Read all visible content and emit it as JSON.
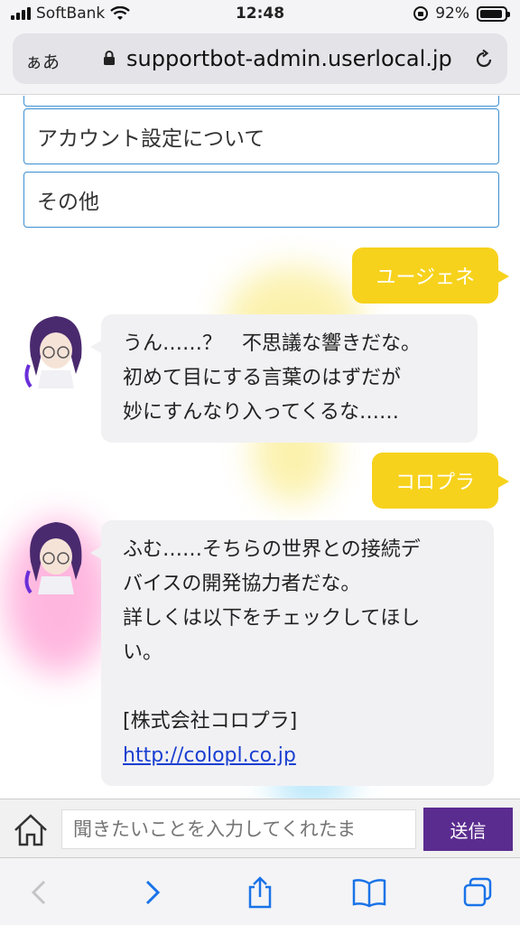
{
  "status": {
    "carrier": "SoftBank",
    "time": "12:48",
    "battery_text": "92%",
    "battery_level": 0.92
  },
  "browser": {
    "aa_label": "ぁあ",
    "url": "supportbot-admin.userlocal.jp",
    "icons": [
      "padlock-icon",
      "reload-icon"
    ]
  },
  "chat": {
    "choices": [
      "アカウント設定について",
      "その他"
    ],
    "user_messages": [
      "ユージェネ",
      "コロプラ"
    ],
    "bot_message_1": {
      "lines": [
        "うん……？　不思議な響きだな。",
        "初めて目にする言葉のはずだが",
        "妙にすんなり入ってくるな……"
      ]
    },
    "bot_message_2": {
      "lines": [
        "ふむ……そちらの世界との接続デ",
        "バイスの開発協力者だな。",
        "詳しくは以下をチェックしてほし",
        "い。"
      ],
      "company": "[株式会社コロプラ]",
      "link": "http://colopl.co.jp"
    }
  },
  "input": {
    "placeholder": "聞きたいことを入力してくれたま",
    "send_label": "送信"
  },
  "colors": {
    "user_bubble": "#f7d21c",
    "bot_bubble": "#f1f1f3",
    "choice_border": "#3d8fd1",
    "send_button": "#5b2c8f",
    "link": "#1a3fd1"
  }
}
